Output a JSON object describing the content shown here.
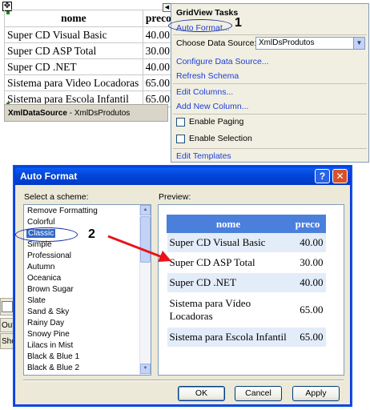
{
  "design_surface": {
    "grid_headers": [
      "nome",
      "preco"
    ],
    "grid_rows": [
      [
        "Super CD Visual Basic",
        "40.00"
      ],
      [
        "Super CD ASP Total",
        "30.00"
      ],
      [
        "Super CD .NET",
        "40.00"
      ],
      [
        "Sistema para Video Locadoras",
        "65.00"
      ],
      [
        "Sistema para Escola Infantil",
        "65.00"
      ]
    ],
    "datasource_type": "XmlDataSource",
    "datasource_sep": " - ",
    "datasource_id": "XmlDsProdutos"
  },
  "tasks_panel": {
    "title": "GridView Tasks",
    "auto_format": "Auto Format...",
    "choose_ds_label": "Choose Data Source:",
    "choose_ds_value": "XmlDsProdutos",
    "configure_ds": "Configure Data Source...",
    "refresh_schema": "Refresh Schema",
    "edit_columns": "Edit Columns...",
    "add_column": "Add New Column...",
    "enable_paging": "Enable Paging",
    "enable_selection": "Enable Selection",
    "edit_templates": "Edit Templates"
  },
  "callouts": {
    "one": "1",
    "two": "2",
    "color": "#e8141a"
  },
  "vs_fragments": {
    "output": "Outp",
    "show": "Sho"
  },
  "dialog": {
    "title": "Auto Format",
    "help": "?",
    "close": "✕",
    "scheme_label": "Select a scheme:",
    "preview_label": "Preview:",
    "schemes": [
      "Remove Formatting",
      "Colorful",
      "Classic",
      "Simple",
      "Professional",
      "Autumn",
      "Oceanica",
      "Brown Sugar",
      "Slate",
      "Sand & Sky",
      "Rainy Day",
      "Snowy Pine",
      "Lilacs in Mist",
      "Black & Blue 1",
      "Black & Blue 2"
    ],
    "selected_scheme": "Classic",
    "preview_headers": [
      "nome",
      "preco"
    ],
    "preview_rows": [
      [
        "Super CD Visual Basic",
        "40.00"
      ],
      [
        "Super CD ASP Total",
        "30.00"
      ],
      [
        "Super CD .NET",
        "40.00"
      ],
      [
        "Sistema para Vídeo Locadoras",
        "65.00"
      ],
      [
        "Sistema para Escola Infantil",
        "65.00"
      ]
    ],
    "ok": "OK",
    "cancel": "Cancel",
    "apply": "Apply"
  },
  "icons": {
    "move": "move-handle-icon",
    "smart_tag": "smart-tag-arrow-icon",
    "dropdown": "chevron-down-icon",
    "scroll_up": "scroll-up-icon",
    "scroll_down": "scroll-down-icon"
  }
}
